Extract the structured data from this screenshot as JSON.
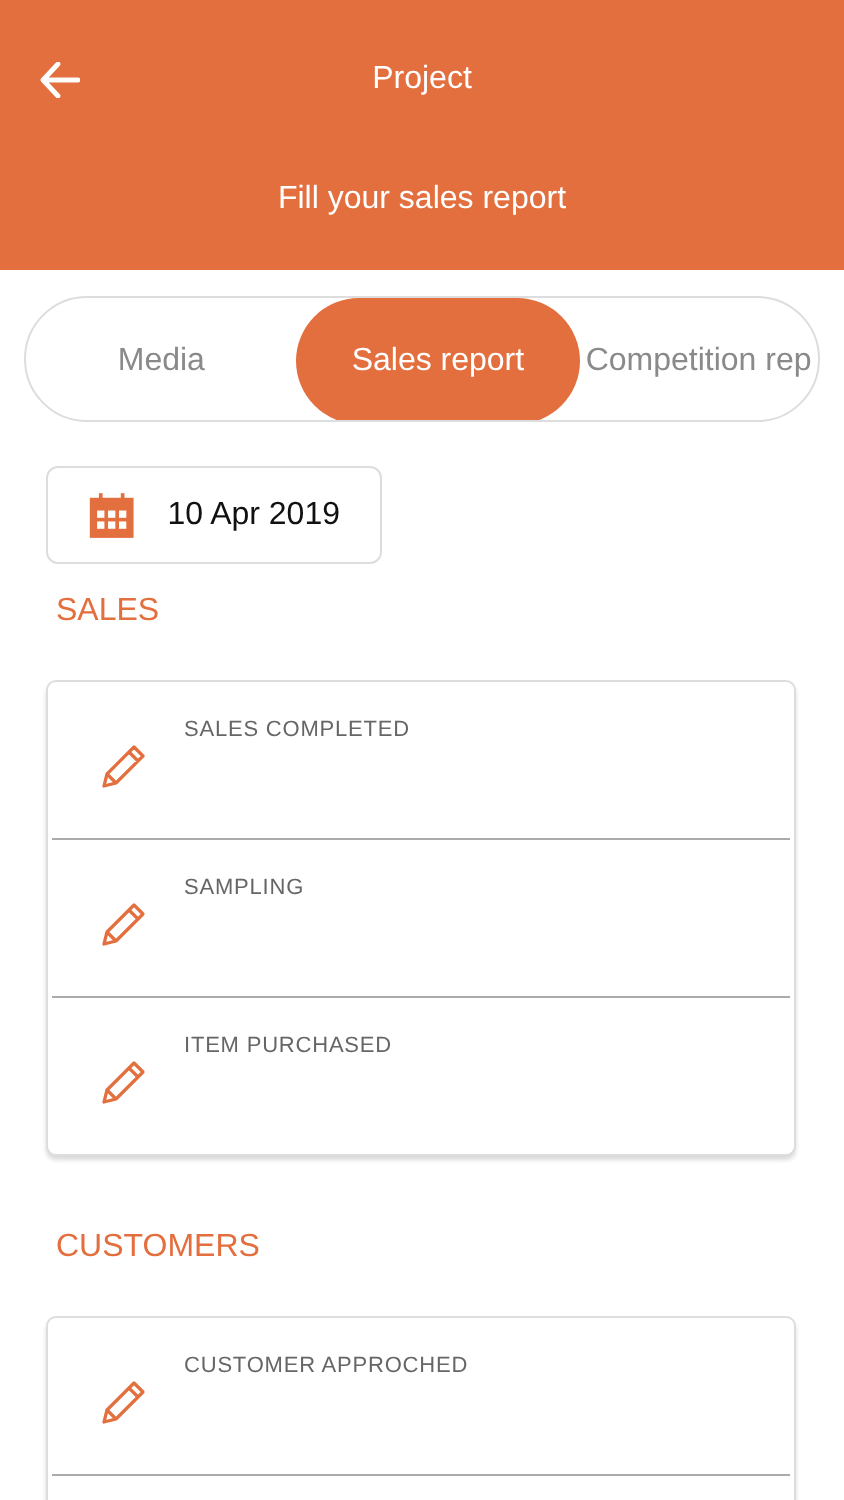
{
  "header": {
    "title": "Project",
    "subtitle": "Fill your sales report"
  },
  "tabs": [
    {
      "label": "Media",
      "selected": false
    },
    {
      "label": "Sales report",
      "selected": true
    },
    {
      "label": "Competition rep",
      "selected": false
    }
  ],
  "date": "10 Apr 2019",
  "sections": [
    {
      "title": "SALES",
      "items": [
        {
          "label": "SALES COMPLETED"
        },
        {
          "label": "SAMPLING"
        },
        {
          "label": "ITEM PURCHASED"
        }
      ]
    },
    {
      "title": "CUSTOMERS",
      "items": [
        {
          "label": "CUSTOMER APPROCHED"
        }
      ]
    }
  ]
}
